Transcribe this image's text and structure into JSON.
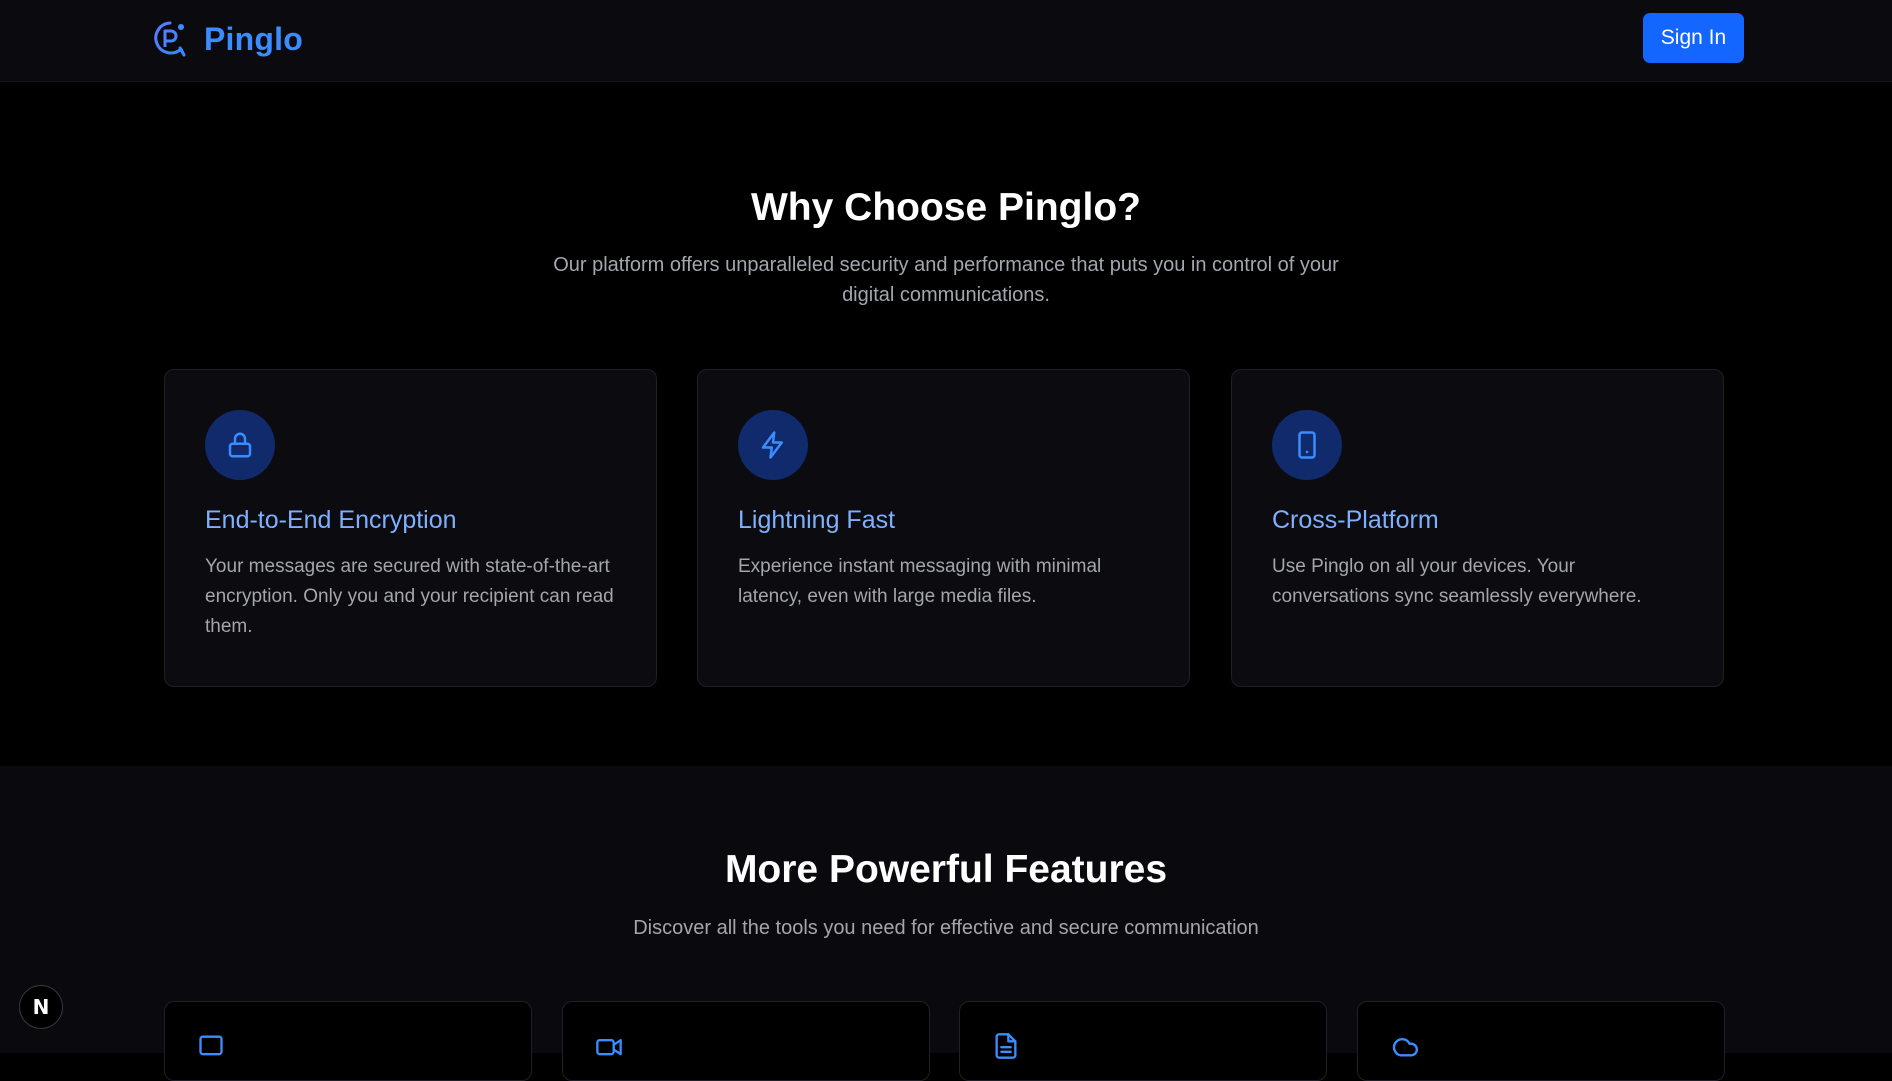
{
  "navbar": {
    "brand_name": "Pinglo",
    "brand_icon": "pinglo-logo-icon",
    "signin_label": "Sign In"
  },
  "why_section": {
    "title": "Why Choose Pinglo?",
    "subtitle": "Our platform offers unparalleled security and performance that puts you in control of your digital communications.",
    "cards": [
      {
        "icon": "lock-icon",
        "title": "End-to-End Encryption",
        "description": "Your messages are secured with state-of-the-art encryption. Only you and your recipient can read them."
      },
      {
        "icon": "lightning-icon",
        "title": "Lightning Fast",
        "description": "Experience instant messaging with minimal latency, even with large media files."
      },
      {
        "icon": "tablet-icon",
        "title": "Cross-Platform",
        "description": "Use Pinglo on all your devices. Your conversations sync seamlessly everywhere."
      }
    ]
  },
  "more_section": {
    "title": "More Powerful Features",
    "subtitle": "Discover all the tools you need for effective and secure communication",
    "cards": [
      {
        "icon": "chat-square-icon"
      },
      {
        "icon": "video-camera-icon"
      },
      {
        "icon": "document-icon"
      },
      {
        "icon": "cloud-icon"
      }
    ]
  },
  "next_badge": {
    "label": "N"
  },
  "colors": {
    "accent": "#1366ff",
    "brand_text": "#3b8cff",
    "card_title": "#7eb0ff",
    "icon_circle": "#112a6c",
    "muted_text": "#a3a6ad",
    "background": "#000000",
    "navbar_bg": "#0b0b0f"
  }
}
